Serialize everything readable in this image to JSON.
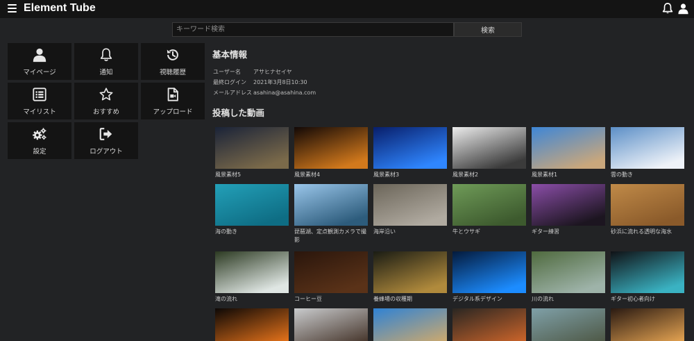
{
  "header": {
    "app_title": "Element Tube",
    "menu_icon": "hamburger-menu-icon",
    "notification_icon": "bell-icon",
    "account_icon": "user-icon"
  },
  "search": {
    "placeholder": "キーワード検索",
    "button_label": "検索"
  },
  "sidebar_menu": [
    {
      "label": "マイページ",
      "icon": "user-icon"
    },
    {
      "label": "通知",
      "icon": "bell-icon"
    },
    {
      "label": "視聴履歴",
      "icon": "history-icon"
    },
    {
      "label": "マイリスト",
      "icon": "list-icon"
    },
    {
      "label": "おすすめ",
      "icon": "star-icon"
    },
    {
      "label": "アップロード",
      "icon": "file-video-icon"
    },
    {
      "label": "設定",
      "icon": "gears-icon"
    },
    {
      "label": "ログアウト",
      "icon": "sign-out-icon"
    }
  ],
  "profile": {
    "heading": "基本情報",
    "username_label": "ユーザー名",
    "username": "アサヒナセイヤ",
    "last_login_label": "最終ログイン",
    "last_login": "2021年3月8日10:30",
    "email_label": "メールアドレス",
    "email": "asahina@asahina.com"
  },
  "videos": {
    "heading": "投稿した動画",
    "items": [
      {
        "title": "風景素材5",
        "thumb_colors": [
          "#1a2338",
          "#7b6a4a"
        ]
      },
      {
        "title": "風景素材4",
        "thumb_colors": [
          "#120806",
          "#d2791c"
        ]
      },
      {
        "title": "風景素材3",
        "thumb_colors": [
          "#081e6a",
          "#2f86ff"
        ]
      },
      {
        "title": "風景素材2",
        "thumb_colors": [
          "#ececec",
          "#3b3b3b"
        ]
      },
      {
        "title": "風景素材1",
        "thumb_colors": [
          "#3e86d6",
          "#c9a77c"
        ]
      },
      {
        "title": "雲の動き",
        "thumb_colors": [
          "#5c8fc7",
          "#eef2f8"
        ]
      },
      {
        "title": "海の動き",
        "thumb_colors": [
          "#23a0b8",
          "#0e6d84"
        ]
      },
      {
        "title": "琵琶湖、定点観測カメラで撮影",
        "thumb_colors": [
          "#9ac6ea",
          "#2d5c7c"
        ]
      },
      {
        "title": "海岸沿い",
        "thumb_colors": [
          "#6b6559",
          "#b0aaa0"
        ]
      },
      {
        "title": "牛とウサギ",
        "thumb_colors": [
          "#6f9b58",
          "#3d5a2e"
        ]
      },
      {
        "title": "ギター練習",
        "thumb_colors": [
          "#8b4ea8",
          "#1c1520"
        ]
      },
      {
        "title": "砂浜に流れる透明な海水",
        "thumb_colors": [
          "#c08a48",
          "#8a5a2a"
        ]
      },
      {
        "title": "滝の流れ",
        "thumb_colors": [
          "#2c3a22",
          "#dfe6e3"
        ]
      },
      {
        "title": "コーヒー豆",
        "thumb_colors": [
          "#2a160c",
          "#5a3218"
        ]
      },
      {
        "title": "養蜂場の収穫期",
        "thumb_colors": [
          "#1a1c14",
          "#b08a3c"
        ]
      },
      {
        "title": "デジタル系デザイン",
        "thumb_colors": [
          "#041a3c",
          "#1c8cff"
        ]
      },
      {
        "title": "川の流れ",
        "thumb_colors": [
          "#4f6a3e",
          "#9eb3a9"
        ]
      },
      {
        "title": "ギター初心者向け",
        "thumb_colors": [
          "#101216",
          "#3ab2c2"
        ]
      },
      {
        "title": "",
        "thumb_colors": [
          "#0d0806",
          "#e0701a"
        ]
      },
      {
        "title": "",
        "thumb_colors": [
          "#c9cbcd",
          "#4a3a30"
        ]
      },
      {
        "title": "",
        "thumb_colors": [
          "#2f82d4",
          "#c9a870"
        ]
      },
      {
        "title": "",
        "thumb_colors": [
          "#2a2622",
          "#c8632a"
        ]
      },
      {
        "title": "",
        "thumb_colors": [
          "#7fa0a8",
          "#4f5a48"
        ]
      },
      {
        "title": "",
        "thumb_colors": [
          "#2a1a12",
          "#e0a050"
        ]
      }
    ]
  }
}
